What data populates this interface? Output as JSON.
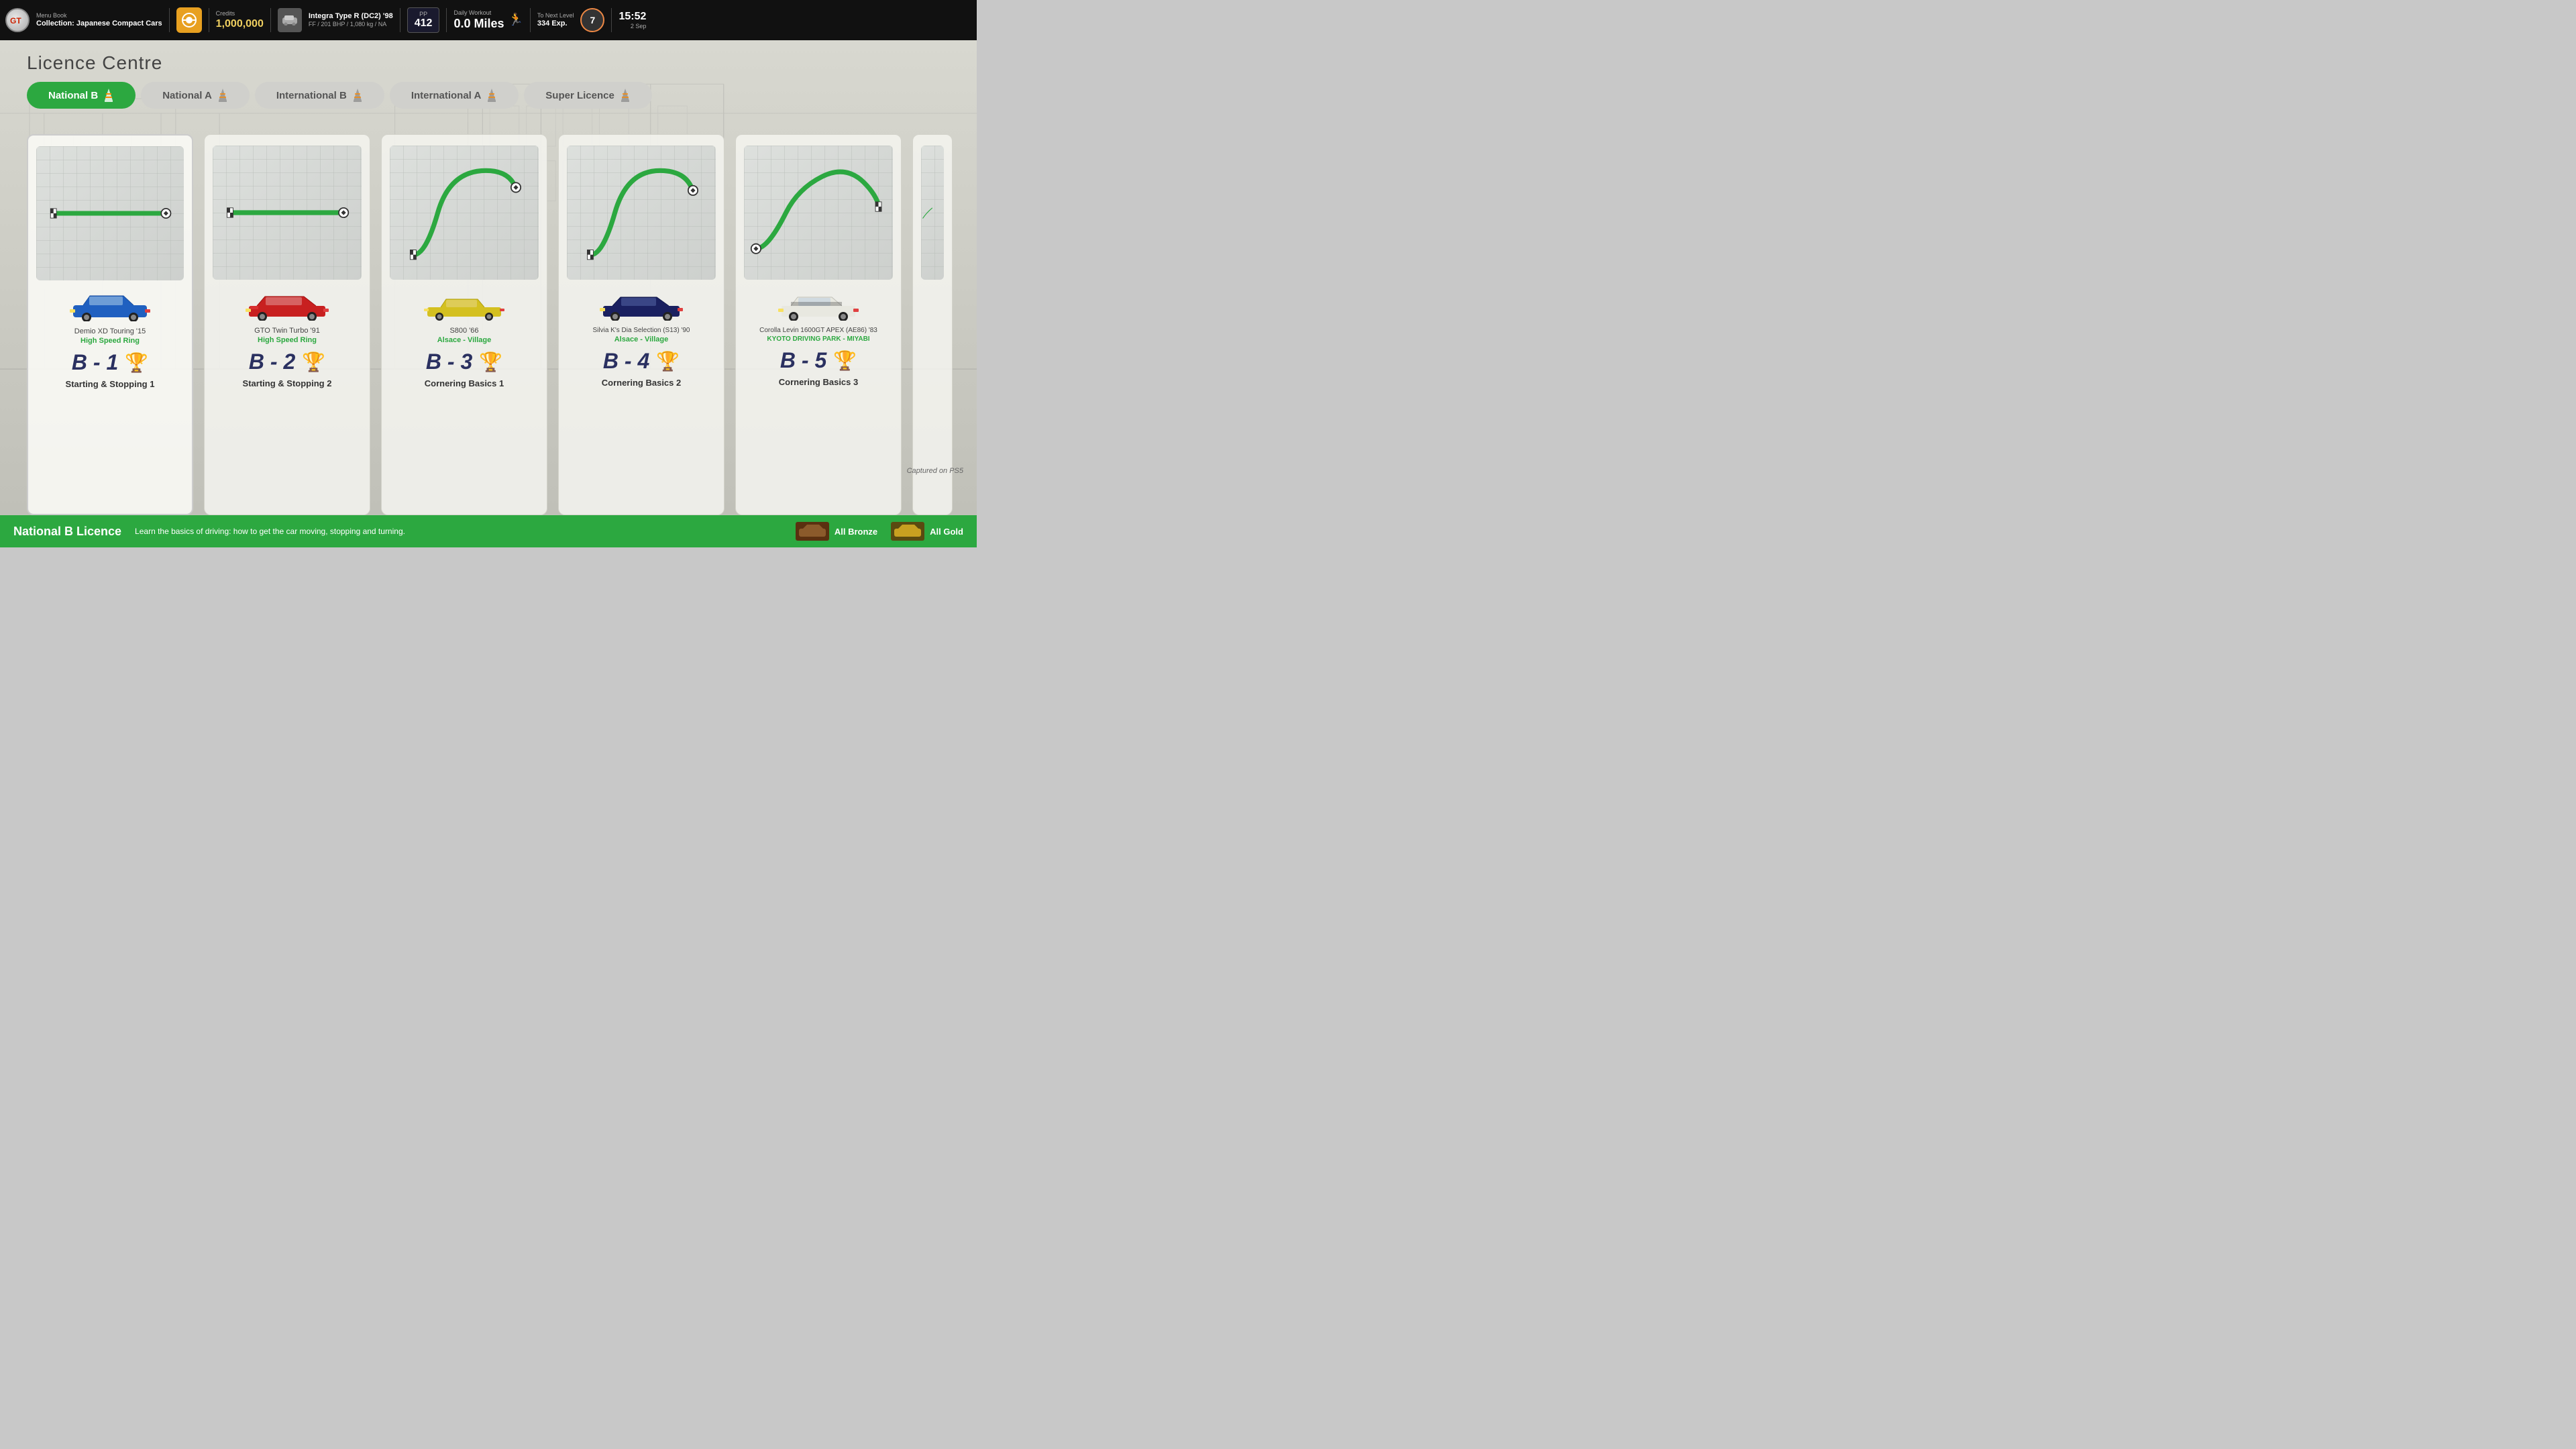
{
  "topbar": {
    "logo": "GT",
    "menu_label": "Menu Book",
    "collection_label": "Collection: Japanese Compact Cars",
    "credits_label": "Credits",
    "credits_value": "1,000,000",
    "car_name": "Integra Type R (DC2) '98",
    "car_specs": "FF / 201 BHP / 1,080 kg / NA",
    "pp_label": "PP",
    "pp_value": "412",
    "workout_label": "Daily Workout",
    "workout_value": "0.0 Miles",
    "next_level_label": "To Next Level",
    "next_level_value": "334 Exp.",
    "level_number": "7",
    "time_value": "15:52",
    "time_date": "2 Sep"
  },
  "page": {
    "title": "Licence Centre"
  },
  "tabs": [
    {
      "label": "National B",
      "active": true,
      "has_cone": true
    },
    {
      "label": "National A",
      "active": false,
      "has_cone": true
    },
    {
      "label": "International B",
      "active": false,
      "has_cone": true
    },
    {
      "label": "International A",
      "active": false,
      "has_cone": true
    },
    {
      "label": "Super Licence",
      "active": false,
      "has_cone": true
    }
  ],
  "cards": [
    {
      "id": "B-1",
      "car_name": "Demio XD Touring '15",
      "track_name": "High Speed Ring",
      "lesson_code": "B - 1",
      "lesson_title": "Starting & Stopping 1",
      "trophy": "silver",
      "track_type": "straight",
      "car_color": "blue"
    },
    {
      "id": "B-2",
      "car_name": "GTO Twin Turbo '91",
      "track_name": "High Speed Ring",
      "lesson_code": "B - 2",
      "lesson_title": "Starting & Stopping 2",
      "trophy": "bronze",
      "track_type": "straight2",
      "car_color": "red"
    },
    {
      "id": "B-3",
      "car_name": "S800 '66",
      "track_name": "Alsace - Village",
      "lesson_code": "B - 3",
      "lesson_title": "Cornering Basics 1",
      "trophy": "gold",
      "track_type": "curve_right",
      "car_color": "yellow"
    },
    {
      "id": "B-4",
      "car_name": "Silvia K's Dia Selection (S13) '90",
      "track_name": "Alsace - Village",
      "lesson_code": "B - 4",
      "lesson_title": "Cornering Basics 2",
      "trophy": "silver",
      "track_type": "curve_left",
      "car_color": "dark_blue"
    },
    {
      "id": "B-5",
      "car_name": "Corolla Levin 1600GT APEX (AE86) '83",
      "track_name": "KYOTO DRIVING PARK - MIYABI",
      "lesson_code": "B - 5",
      "lesson_title": "Cornering Basics 3",
      "trophy": "silver",
      "track_type": "curve_smooth",
      "car_color": "white"
    }
  ],
  "bottom_bar": {
    "title": "National B Licence",
    "description": "Learn the basics of driving: how to get the car moving, stopping and turning.",
    "all_bronze_label": "All Bronze",
    "all_gold_label": "All Gold"
  },
  "captured_text": "Captured on PS5"
}
